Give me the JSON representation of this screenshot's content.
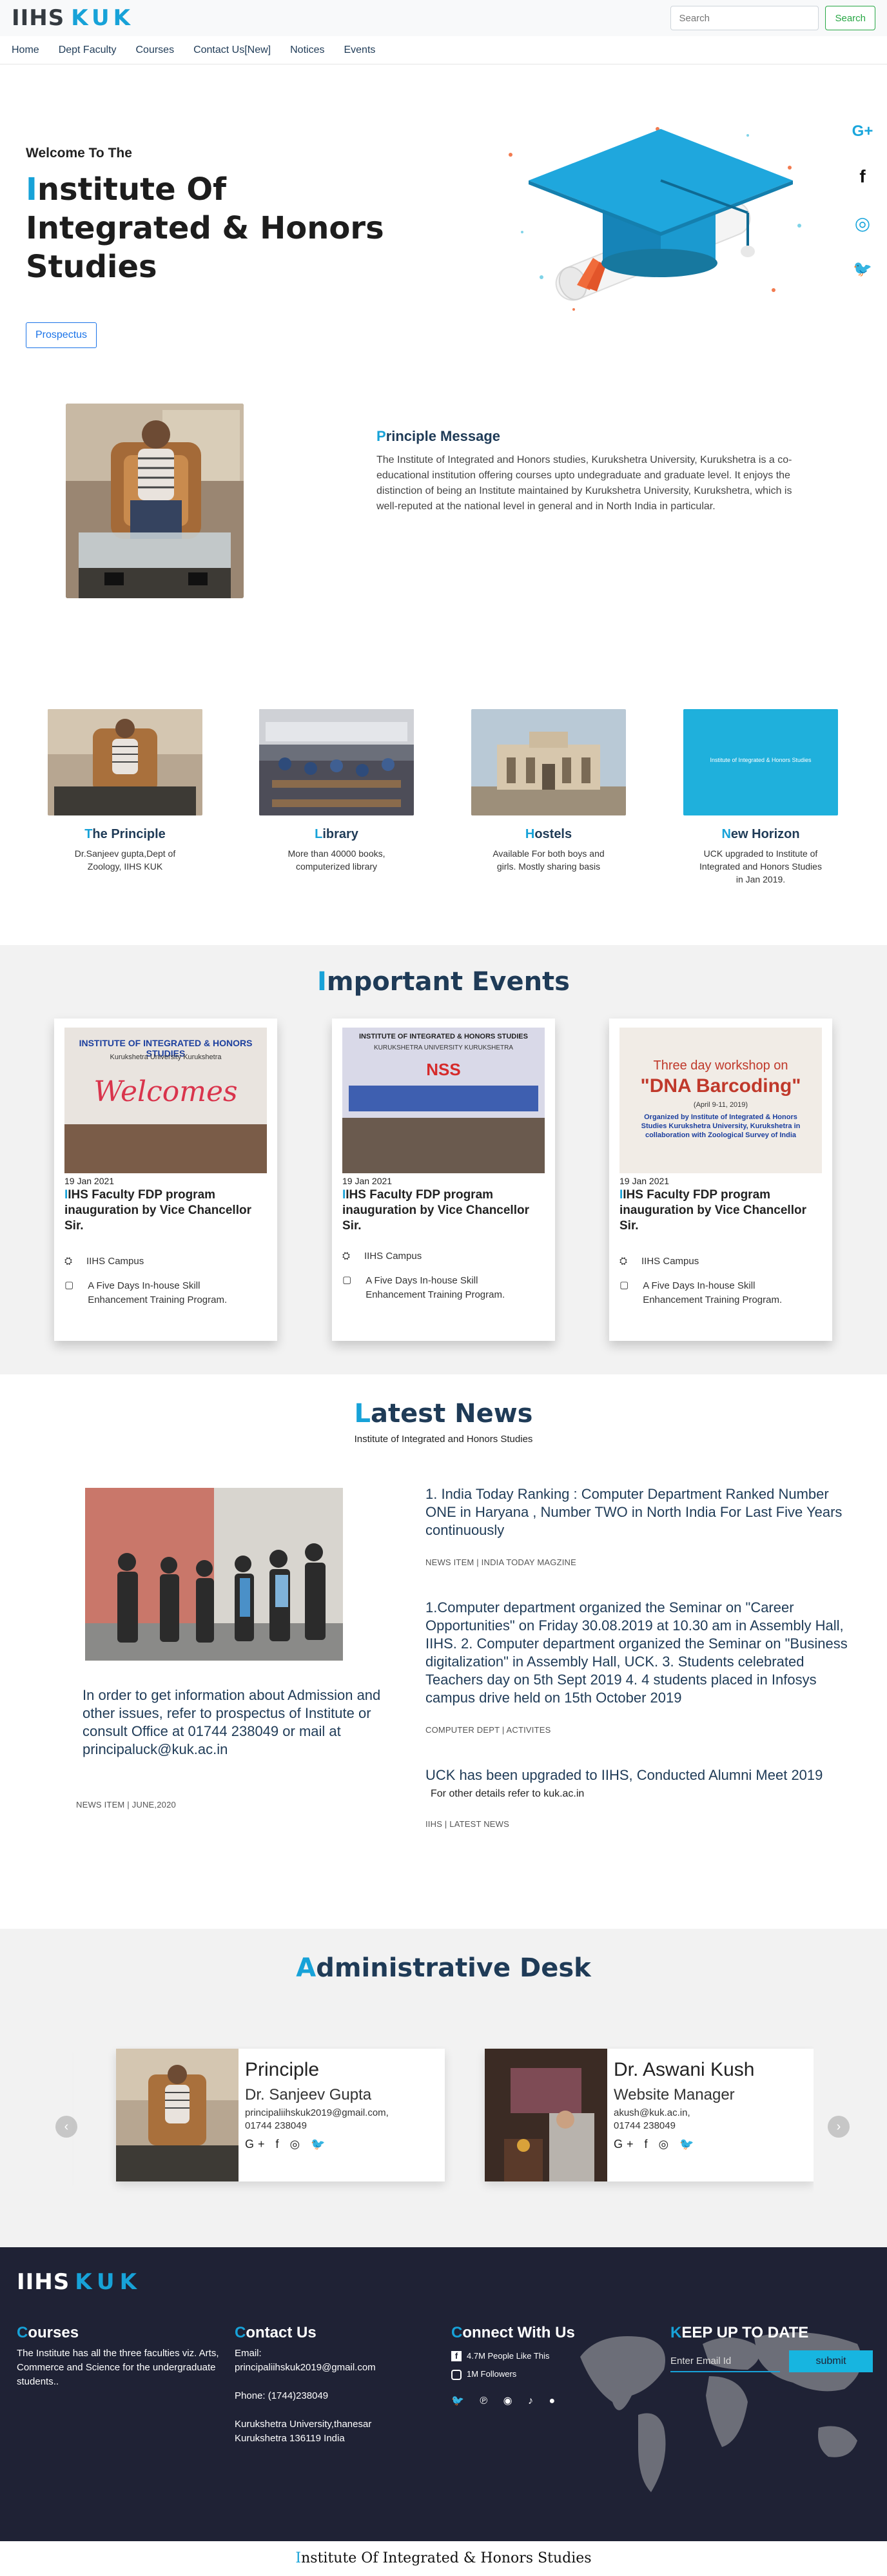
{
  "nav": {
    "brand_main": "IIHS",
    "brand_accent": "KUK",
    "search_placeholder": "Search",
    "search_button": "Search",
    "menu": [
      "Home",
      "Dept Faculty",
      "Courses",
      "Contact Us[New]",
      "Notices",
      "Events"
    ]
  },
  "hero": {
    "welcome": "Welcome To The",
    "title_first": "I",
    "title_rest": "nstitute Of Integrated & Honors Studies",
    "button": "Prospectus",
    "social_icons": [
      "google-plus-icon",
      "facebook-icon",
      "instagram-icon",
      "twitter-icon"
    ],
    "social_glyphs": [
      "G+",
      "f",
      "◎",
      "🐦"
    ]
  },
  "principle": {
    "title_first": "P",
    "title_rest": "rinciple Message",
    "body": "The Institute of Integrated and Honors studies, Kurukshetra University, Kurukshetra is a co-educational institution offering courses upto undegraduate and graduate level. It enjoys the distinction of being an Institute maintained by Kurukshetra University, Kurukshetra, which is well-reputed at the national level in general and in North India in particular."
  },
  "features": [
    {
      "title_first": "T",
      "title_rest": "he Principle",
      "desc": "Dr.Sanjeev gupta,Dept of Zoology, IIHS KUK"
    },
    {
      "title_first": "L",
      "title_rest": "ibrary",
      "desc": "More than 40000 books, computerized library"
    },
    {
      "title_first": "H",
      "title_rest": "ostels",
      "desc": "Available For both boys and girls. Mostly sharing basis"
    },
    {
      "title_first": "N",
      "title_rest": "ew Horizon",
      "desc": "UCK upgraded to Institute of Integrated and Honors Studies in Jan 2019."
    }
  ],
  "feature_banner_text": "Institute of Integrated & Honors Studies",
  "events": {
    "title_first": "I",
    "title_rest": "mportant Events",
    "cards": [
      {
        "date": "19 Jan 2021",
        "title_first": "I",
        "title_rest": "IHS Faculty FDP program inauguration by Vice Chancellor Sir.",
        "location": "IIHS Campus",
        "note": "A Five Days In-house Skill Enhancement Training Program.",
        "banner_top": "INSTITUTE OF INTEGRATED & HONORS STUDIES",
        "banner_sub": "Kurukshetra University Kurukshetra",
        "banner_word": "Welcomes"
      },
      {
        "date": "19 Jan 2021",
        "title_first": "I",
        "title_rest": "IHS Faculty FDP program inauguration by Vice Chancellor Sir.",
        "location": "IIHS Campus",
        "note": "A Five Days In-house Skill Enhancement Training Program.",
        "banner_top": "INSTITUTE OF INTEGRATED & HONORS STUDIES",
        "banner_sub": "KURUKSHETRA UNIVERSITY KURUKSHETRA",
        "banner_word": "NSS"
      },
      {
        "date": "19 Jan 2021",
        "title_first": "I",
        "title_rest": "IHS Faculty FDP program inauguration by Vice Chancellor Sir.",
        "location": "IIHS Campus",
        "note": "A Five Days In-house Skill Enhancement Training Program.",
        "banner_top": "Three day workshop on",
        "banner_sub": "(April 9-11, 2019)",
        "banner_word": "\"DNA Barcoding\"",
        "banner_org": "Organized by Institute of Integrated & Honors Studies Kurukshetra University, Kurukshetra in collaboration with Zoological Survey of India"
      }
    ]
  },
  "news": {
    "title_first": "L",
    "title_rest": "atest News",
    "subtitle": "Institute of Integrated and Honors Studies",
    "left_text": "In order to get information about Admission and other issues, refer to prospectus of Institute or consult Office at 01744 238049 or mail at principaluck@kuk.ac.in",
    "left_meta": "NEWS ITEM | JUNE,2020",
    "items": [
      {
        "body": "1. India Today Ranking : Computer Department Ranked Number ONE in Haryana , Number TWO in North India For Last Five Years continuously",
        "extra": "",
        "meta": "NEWS ITEM | INDIA TODAY MAGZINE"
      },
      {
        "body": "1.Computer department organized the Seminar on \"Career Opportunities\" on Friday 30.08.2019 at 10.30 am in Assembly Hall, IIHS. 2. Computer department organized the Seminar on \"Business digitalization\" in Assembly Hall, UCK. 3. Students celebrated Teachers day on 5th Sept 2019 4. 4 students placed in Infosys campus drive held on 15th October 2019",
        "extra": "",
        "meta": "COMPUTER DEPT | ACTIVITES"
      },
      {
        "body": "UCK has been upgraded to IIHS, Conducted Alumni Meet 2019",
        "extra": "For other details refer to kuk.ac.in",
        "meta": "IIHS | LATEST NEWS"
      }
    ]
  },
  "admin": {
    "title_first": "A",
    "title_rest": "dministrative Desk",
    "cards": [
      {
        "role": "Principle",
        "name": "Dr. Sanjeev Gupta",
        "email": "principaliihskuk2019@gmail.com,",
        "phone": "01744 238049"
      },
      {
        "role": "Dr. Aswani Kush",
        "name": "Website Manager",
        "email": "akush@kuk.ac.in,",
        "phone": "01744 238049"
      }
    ],
    "social_glyphs": "G+ f ◎ 🐦"
  },
  "footer": {
    "brand_main": "IIHS",
    "brand_accent": "KUK",
    "courses_first": "C",
    "courses_rest": "ourses",
    "courses_text": "The Institute has all the three faculties viz. Arts, Commerce and Science for the undergraduate students..",
    "contact_first": "C",
    "contact_rest": "ontact Us",
    "contact_email_label": "Email:",
    "contact_email": "principaliihskuk2019@gmail.com",
    "contact_phone": "Phone: (1744)238049",
    "contact_addr1": "Kurukshetra University,thanesar",
    "contact_addr2": "Kurukshetra 136119 India",
    "connect_first": "C",
    "connect_rest": "onnect With Us",
    "facebook_count": "4.7M People Like This",
    "instagram_count": "1M Followers",
    "social_row": "🐦 ℗ ◉ ♪ ●",
    "keep_first": "K",
    "keep_rest": "EEP UP TO DATE",
    "email_placeholder": "Enter Email Id",
    "submit": "submit"
  },
  "bottom": {
    "first": "I",
    "rest": "nstitute Of Integrated & Honors Studies"
  }
}
